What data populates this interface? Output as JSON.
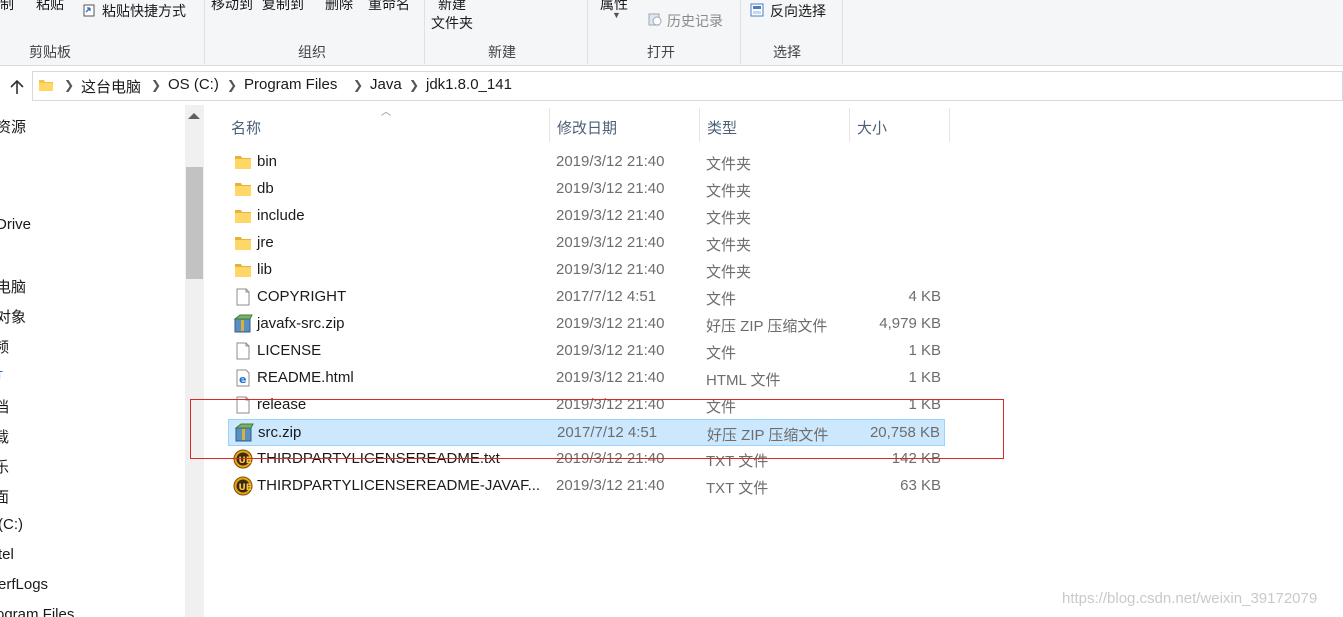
{
  "ribbon": {
    "copy_label": "制",
    "paste_label": "粘贴",
    "paste_shortcut_label": "粘贴快捷方式",
    "move_to_label": "移动到",
    "copy_to_label": "复制到",
    "delete_label": "删除",
    "rename_label": "重命名",
    "new_label": "新建",
    "new_folder_label": "文件夹",
    "properties_label": "属性",
    "history_label": "历史记录",
    "invert_selection_label": "反向选择",
    "groups": {
      "clipboard": "剪贴板",
      "organize": "组织",
      "new": "新建",
      "open": "打开",
      "select": "选择"
    }
  },
  "breadcrumb": [
    "这台电脑",
    "OS (C:)",
    "Program Files",
    "Java",
    "jdk1.8.0_141"
  ],
  "nav_pane": {
    "items": [
      "资源",
      "Drive",
      "电脑",
      "对象",
      "频",
      "т",
      "档",
      "载",
      "乐",
      "面",
      "(C:)",
      "tel",
      "erfLogs",
      "ogram Files"
    ]
  },
  "columns": {
    "name": "名称",
    "date": "修改日期",
    "type": "类型",
    "size": "大小"
  },
  "files": [
    {
      "name": "bin",
      "date": "2019/3/12 21:40",
      "type": "文件夹",
      "size": "",
      "icon": "folder-icon"
    },
    {
      "name": "db",
      "date": "2019/3/12 21:40",
      "type": "文件夹",
      "size": "",
      "icon": "folder-icon"
    },
    {
      "name": "include",
      "date": "2019/3/12 21:40",
      "type": "文件夹",
      "size": "",
      "icon": "folder-icon"
    },
    {
      "name": "jre",
      "date": "2019/3/12 21:40",
      "type": "文件夹",
      "size": "",
      "icon": "folder-icon"
    },
    {
      "name": "lib",
      "date": "2019/3/12 21:40",
      "type": "文件夹",
      "size": "",
      "icon": "folder-icon"
    },
    {
      "name": "COPYRIGHT",
      "date": "2017/7/12 4:51",
      "type": "文件",
      "size": "4 KB",
      "icon": "file-icon"
    },
    {
      "name": "javafx-src.zip",
      "date": "2019/3/12 21:40",
      "type": "好压 ZIP 压缩文件",
      "size": "4,979 KB",
      "icon": "zip-archive-icon"
    },
    {
      "name": "LICENSE",
      "date": "2019/3/12 21:40",
      "type": "文件",
      "size": "1 KB",
      "icon": "file-icon"
    },
    {
      "name": "README.html",
      "date": "2019/3/12 21:40",
      "type": "HTML 文件",
      "size": "1 KB",
      "icon": "html-file-icon"
    },
    {
      "name": "release",
      "date": "2019/3/12 21:40",
      "type": "文件",
      "size": "1 KB",
      "icon": "file-icon"
    },
    {
      "name": "src.zip",
      "date": "2017/7/12 4:51",
      "type": "好压 ZIP 压缩文件",
      "size": "20,758 KB",
      "icon": "zip-archive-icon",
      "selected": true
    },
    {
      "name": "THIRDPARTYLICENSEREADME.txt",
      "date": "2019/3/12 21:40",
      "type": "TXT 文件",
      "size": "142 KB",
      "icon": "text-editor-icon"
    },
    {
      "name": "THIRDPARTYLICENSEREADME-JAVAF...",
      "date": "2019/3/12 21:40",
      "type": "TXT 文件",
      "size": "63 KB",
      "icon": "text-editor-icon"
    }
  ],
  "watermark": "https://blog.csdn.net/weixin_39172079",
  "colors": {
    "selection_bg": "#cce8ff",
    "selection_border": "#99d1ff",
    "annotation_box": "#d42a2a",
    "folder": "#f4c542"
  }
}
